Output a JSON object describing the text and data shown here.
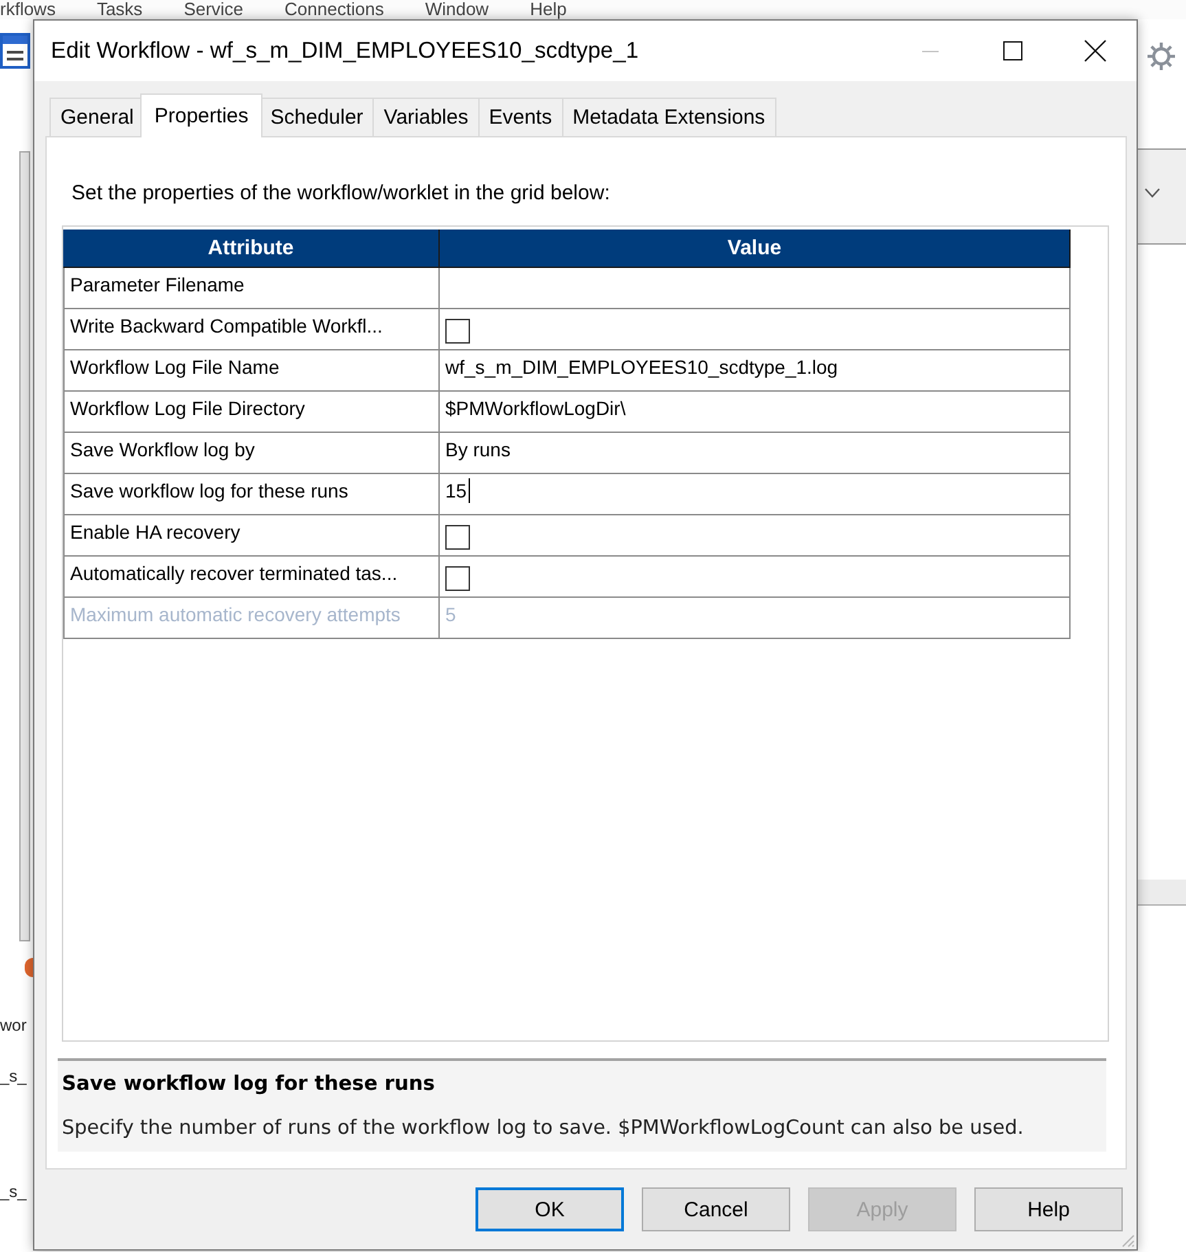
{
  "app_menu": [
    "rkflows",
    "Tasks",
    "Service",
    "Connections",
    "Window",
    "Help"
  ],
  "app_fragments": [
    "wor",
    "_s_",
    "_s_"
  ],
  "window": {
    "title": "Edit Workflow - wf_s_m_DIM_EMPLOYEES10_scdtype_1"
  },
  "tabs": [
    {
      "label": "General",
      "selected": false
    },
    {
      "label": "Properties",
      "selected": true
    },
    {
      "label": "Scheduler",
      "selected": false
    },
    {
      "label": "Variables",
      "selected": false
    },
    {
      "label": "Events",
      "selected": false
    },
    {
      "label": "Metadata Extensions",
      "selected": false
    }
  ],
  "instruction": "Set the properties of the workflow/worklet in the grid below:",
  "grid": {
    "columns": [
      "Attribute",
      "Value"
    ],
    "rows": [
      {
        "attribute": "Parameter Filename",
        "kind": "text",
        "disabled": false
      },
      {
        "attribute": "Write Backward Compatible Workfl...",
        "kind": "checkbox",
        "checked": false,
        "disabled": false
      },
      {
        "attribute": "Workflow Log File Name",
        "kind": "text",
        "value": "wf_s_m_DIM_EMPLOYEES10_scdtype_1.log",
        "disabled": false
      },
      {
        "attribute": "Workflow Log File Directory",
        "kind": "text",
        "value": "$PMWorkflowLogDir\\",
        "disabled": false
      },
      {
        "attribute": "Save Workflow log by",
        "kind": "text",
        "value": "By runs",
        "disabled": false
      },
      {
        "attribute": "Save workflow log for these runs",
        "kind": "input",
        "value": "15",
        "disabled": false
      },
      {
        "attribute": "Enable HA recovery",
        "kind": "checkbox",
        "checked": false,
        "disabled": false
      },
      {
        "attribute": "Automatically recover terminated tas...",
        "kind": "checkbox",
        "checked": false,
        "disabled": false
      },
      {
        "attribute": "Maximum automatic recovery attempts",
        "kind": "text",
        "value": "5",
        "disabled": true
      }
    ]
  },
  "description": {
    "title": "Save workflow log for these runs",
    "text": "Specify the number of runs of the workflow log to save. $PMWorkflowLogCount can also be used."
  },
  "buttons": [
    {
      "label": "OK",
      "default": true,
      "disabled": false
    },
    {
      "label": "Cancel",
      "default": false,
      "disabled": false
    },
    {
      "label": "Apply",
      "default": false,
      "disabled": true
    },
    {
      "label": "Help",
      "default": false,
      "disabled": false
    }
  ]
}
